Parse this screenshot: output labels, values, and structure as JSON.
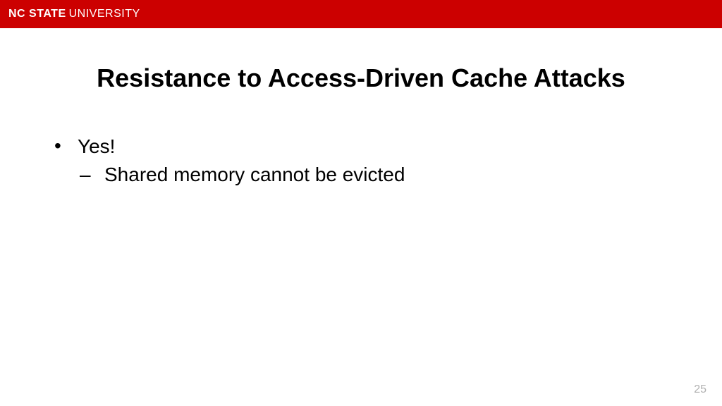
{
  "header": {
    "brand_bold": "NC STATE",
    "brand_light": "UNIVERSITY"
  },
  "slide": {
    "title": "Resistance to Access-Driven Cache Attacks",
    "bullets": {
      "item1": "Yes!",
      "sub1": "Shared memory cannot be evicted"
    },
    "page_number": "25"
  },
  "colors": {
    "brand_red": "#cc0000"
  }
}
